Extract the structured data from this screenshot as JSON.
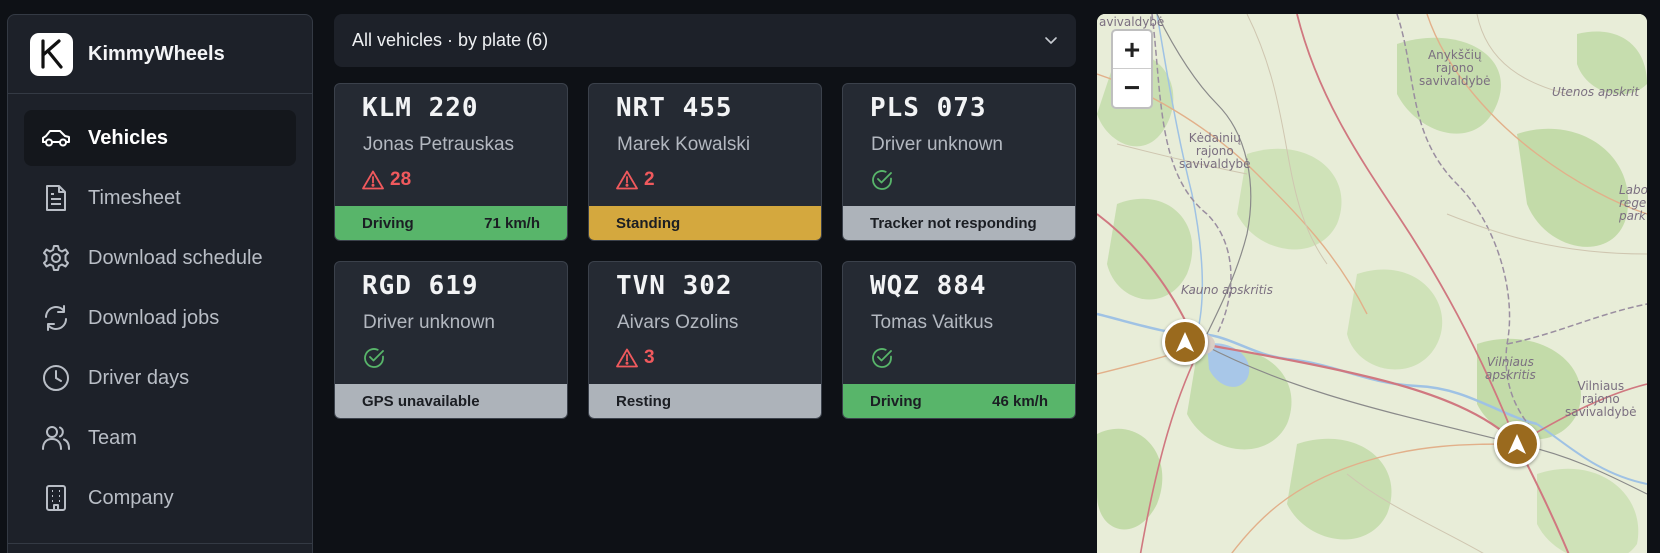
{
  "app": {
    "name": "KimmyWheels",
    "logo_letter": "K"
  },
  "sidebar": {
    "items": [
      {
        "label": "Vehicles",
        "icon": "car-icon",
        "active": true
      },
      {
        "label": "Timesheet",
        "icon": "document-icon"
      },
      {
        "label": "Download schedule",
        "icon": "gear-icon"
      },
      {
        "label": "Download jobs",
        "icon": "refresh-icon"
      },
      {
        "label": "Driver days",
        "icon": "clock-icon"
      },
      {
        "label": "Team",
        "icon": "users-icon"
      },
      {
        "label": "Company",
        "icon": "building-icon"
      }
    ]
  },
  "filter": {
    "label": "All vehicles · by plate (6)",
    "icon": "chevron-down-icon"
  },
  "vehicles": [
    {
      "plate": "KLM 220",
      "driver": "Jonas Petrauskas",
      "alerts": "28",
      "status": "Driving",
      "speed": "71 km/h",
      "status_color": "#58b56a"
    },
    {
      "plate": "NRT 455",
      "driver": "Marek Kowalski",
      "alerts": "2",
      "status": "Standing",
      "speed": "",
      "status_color": "#d4a83e"
    },
    {
      "plate": "PLS 073",
      "driver": "Driver unknown",
      "alerts": "",
      "status": "Tracker not responding",
      "speed": "",
      "status_color": "#adb3ba"
    },
    {
      "plate": "RGD 619",
      "driver": "Driver unknown",
      "alerts": "",
      "status": "GPS unavailable",
      "speed": "",
      "status_color": "#adb3ba"
    },
    {
      "plate": "TVN 302",
      "driver": "Aivars Ozolins",
      "alerts": "3",
      "status": "Resting",
      "speed": "",
      "status_color": "#adb3ba"
    },
    {
      "plate": "WQZ 884",
      "driver": "Tomas Vaitkus",
      "alerts": "",
      "status": "Driving",
      "speed": "46 km/h",
      "status_color": "#58b56a"
    }
  ],
  "map": {
    "zoom_in": "+",
    "zoom_out": "−",
    "labels": {
      "l1": "avivaldybė",
      "l2": "Anykščių\nrajono\nsavivaldybė",
      "l3": "Utenos apskrit",
      "l4": "Kėdainių\nrajono\nsavivaldybė",
      "l5": "Labor\nrege\npark",
      "l6": "Kauno apskritis",
      "l7": "Vilniaus\napskritis",
      "l8": "Vilniaus\nrajono\nsavivaldybė"
    }
  },
  "colors": {
    "accent_alert": "#f0595d",
    "ok": "#58b56a",
    "marker": "#9a6a1e"
  }
}
